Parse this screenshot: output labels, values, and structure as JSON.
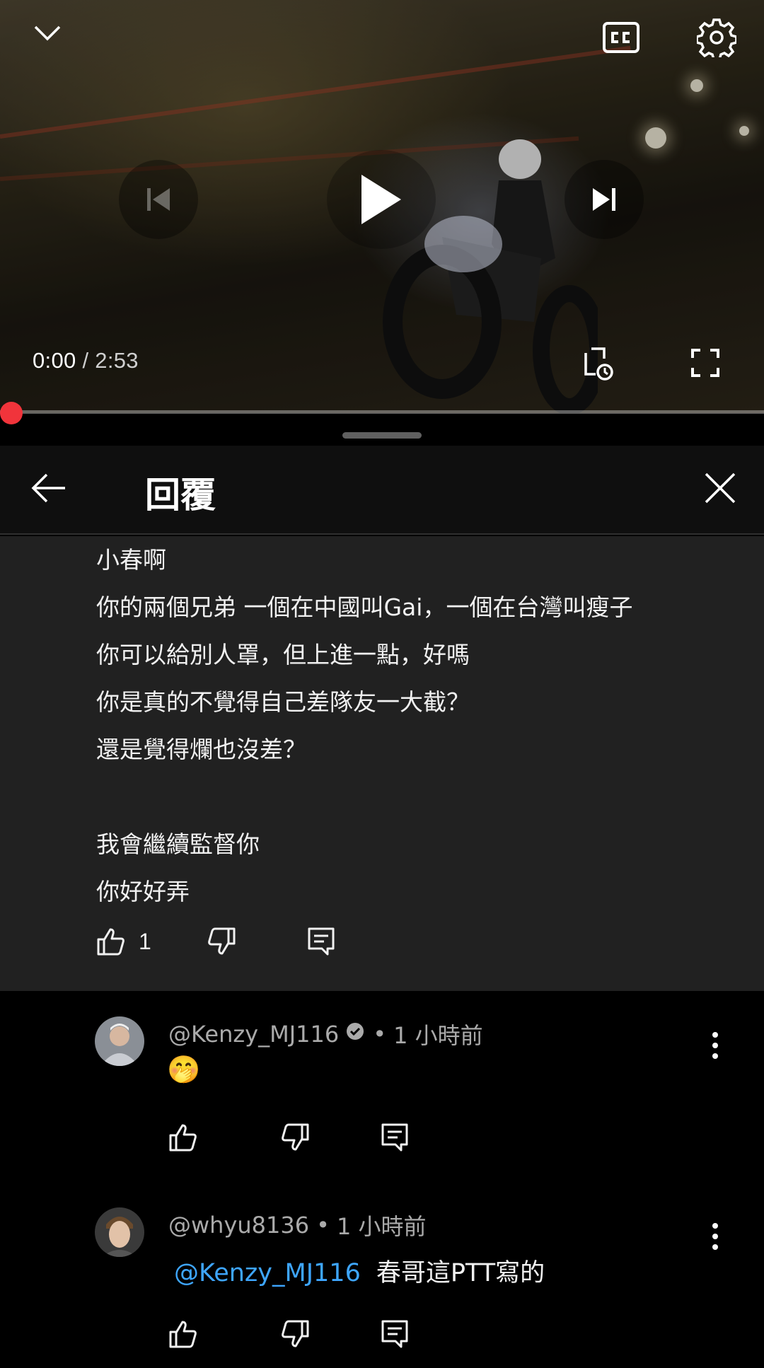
{
  "player": {
    "current_time": "0:00",
    "time_separator": " / ",
    "duration": "2:53",
    "progress": 0.0,
    "icons": {
      "collapse": "chevron-down-icon",
      "captions": "cc-icon",
      "settings": "gear-icon",
      "previous": "skip-previous-icon",
      "play": "play-icon",
      "next": "skip-next-icon",
      "queue": "add-to-queue-icon",
      "fullscreen": "fullscreen-icon"
    },
    "accent_color": "#f1343b"
  },
  "panel": {
    "title": "回覆"
  },
  "parent_comment": {
    "text": "小春啊\n你的兩個兄弟 一個在中國叫Gai，一個在台灣叫瘦子\n你可以給別人罩，但上進一點，好嗎\n你是真的不覺得自己差隊友一大截？\n還是覺得爛也沒差？\n\n我會繼續監督你\n你好好弄",
    "like_count": "1"
  },
  "replies": [
    {
      "handle": "@Kenzy_MJ116",
      "verified": true,
      "separator": "•",
      "time": "1 小時前",
      "content": "🤭"
    },
    {
      "handle": "@whyu8136",
      "verified": false,
      "separator": "•",
      "time": "1 小時前",
      "mention": "@Kenzy_MJ116",
      "content": "春哥這PTT寫的"
    }
  ],
  "colors": {
    "background": "#000000",
    "parent_bg": "#212121",
    "mention": "#3ea6ff",
    "meta": "#aaaaaa"
  }
}
